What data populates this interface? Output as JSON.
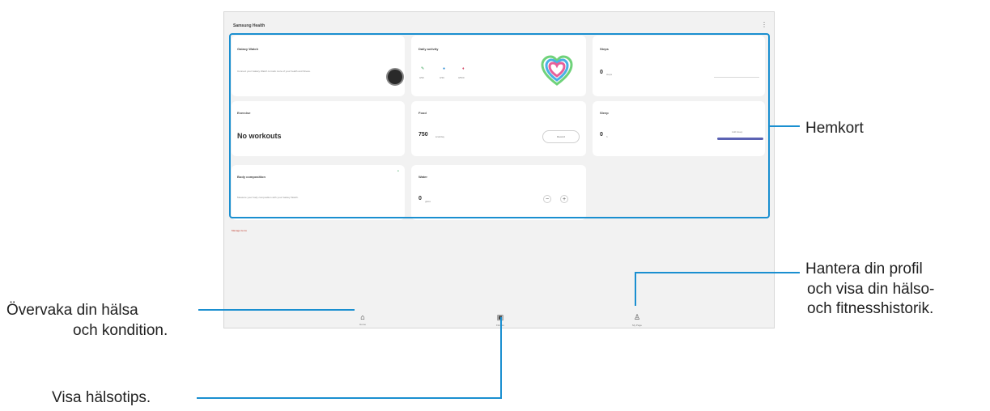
{
  "screen": {
    "title": "Samsung Health",
    "more_icon": "more-vert-icon",
    "cards": {
      "watch": {
        "title": "Galaxy Watch",
        "text": "Connect your Galaxy Watch to track more of your health and fitness."
      },
      "daily": {
        "title": "Daily activity",
        "values": [
          "0/90",
          "0/30",
          "0/500"
        ]
      },
      "steps": {
        "title": "Steps",
        "value": "0",
        "unit": "steps"
      },
      "exercise": {
        "title": "Exercise",
        "value": "No workouts"
      },
      "food": {
        "title": "Food",
        "value": "750",
        "unit": "kcal/day",
        "button": "Record"
      },
      "sleep": {
        "title": "Sleep",
        "value": "0",
        "unit": "h",
        "button": "Add sleep",
        "accent": "#5b62b3"
      },
      "body": {
        "title": "Body composition",
        "text": "Measure your body composition with your Galaxy Watch."
      },
      "water": {
        "title": "Water",
        "value": "0",
        "unit": "glass",
        "minus": "−",
        "plus": "+"
      }
    },
    "manage_link": "Manage items",
    "nav": {
      "home": "Home",
      "together": "Together",
      "fitness": "Fitness",
      "my_page": "My Page"
    }
  },
  "callouts": {
    "home_cards": "Hemkort",
    "profile_line1": "Hantera din profil",
    "profile_line2": "och visa din hälso-",
    "profile_line3": "och fitnesshistorik.",
    "monitor_line1": "Övervaka din hälsa",
    "monitor_line2": "och kondition.",
    "tips": "Visa hälsotips."
  },
  "colors": {
    "accent": "#1a8fd0"
  }
}
